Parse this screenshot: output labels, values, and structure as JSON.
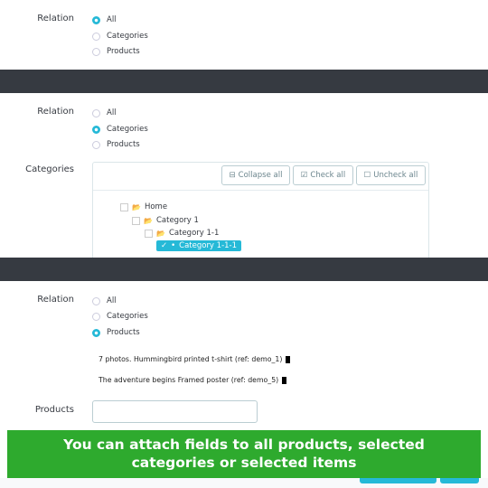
{
  "section1": {
    "label": "Relation",
    "options": [
      "All",
      "Categories",
      "Products"
    ],
    "selected": 0
  },
  "section2": {
    "label": "Relation",
    "options": [
      "All",
      "Categories",
      "Products"
    ],
    "selected": 1,
    "categories_label": "Categories",
    "buttons": {
      "collapse": "Collapse all",
      "check": "Check all",
      "uncheck": "Uncheck all"
    },
    "tree": [
      {
        "label": "Home",
        "level": 0,
        "checked": false
      },
      {
        "label": "Category 1",
        "level": 1,
        "checked": false
      },
      {
        "label": "Category 1-1",
        "level": 2,
        "checked": false
      },
      {
        "label": "Category 1-1-1",
        "level": 3,
        "checked": true
      }
    ]
  },
  "section3": {
    "label": "Relation",
    "options": [
      "All",
      "Categories",
      "Products"
    ],
    "selected": 2,
    "products": [
      "7 photos. Hummingbird printed t-shirt (ref: demo_1)",
      "The adventure begins Framed poster (ref: demo_5)"
    ],
    "products_label": "Products",
    "products_input": ""
  },
  "banner": {
    "line1": "You can attach fields to all products, selected",
    "line2": "categories or selected items"
  },
  "colors": {
    "accent": "#25b9d7",
    "dark_bar": "#363a41",
    "banner": "#2eaa2e"
  }
}
